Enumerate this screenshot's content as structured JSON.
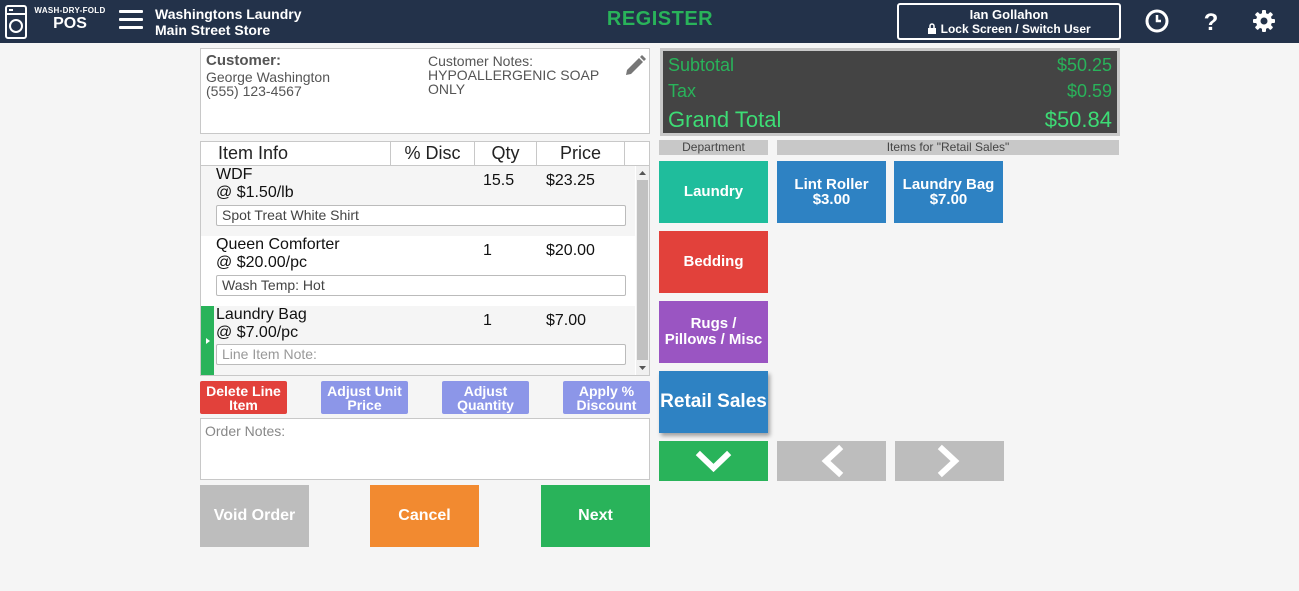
{
  "header": {
    "brand_small": "WASH-DRY-FOLD",
    "brand_big": "POS",
    "store_name": "Washingtons Laundry",
    "store_location": "Main Street Store",
    "title": "REGISTER",
    "user_name": "Ian Gollahon",
    "lock_label": "Lock Screen / Switch User"
  },
  "customer": {
    "label": "Customer:",
    "name": "George Washington",
    "phone": "(555) 123-4567",
    "notes_label": "Customer Notes:",
    "notes_line1": "HYPOALLERGENIC SOAP",
    "notes_line2": "ONLY"
  },
  "table": {
    "headers": [
      "Item Info",
      "% Disc",
      "Qty",
      "Price"
    ],
    "rows": [
      {
        "name": "WDF",
        "rate": "@ $1.50/lb",
        "qty": "15.5",
        "price": "$23.25",
        "note": "Spot Treat White Shirt"
      },
      {
        "name": "Queen Comforter",
        "rate": "@ $20.00/pc",
        "qty": "1",
        "price": "$20.00",
        "note": "Wash Temp: Hot"
      },
      {
        "name": "Laundry Bag",
        "rate": "@ $7.00/pc",
        "qty": "1",
        "price": "$7.00",
        "note_placeholder": "Line Item Note:"
      }
    ]
  },
  "actions": {
    "delete": "Delete Line Item",
    "adjust_price": "Adjust Unit Price",
    "adjust_qty": "Adjust Quantity",
    "apply_discount": "Apply % Discount"
  },
  "order_notes_placeholder": "Order Notes:",
  "buttons": {
    "void": "Void Order",
    "cancel": "Cancel",
    "next": "Next"
  },
  "totals": {
    "subtotal_label": "Subtotal",
    "subtotal": "$50.25",
    "tax_label": "Tax",
    "tax": "$0.59",
    "grand_label": "Grand Total",
    "grand": "$50.84"
  },
  "department_header": "Department",
  "items_header": "Items for \"Retail Sales\"",
  "departments": [
    {
      "label": "Laundry",
      "color": "#1fbd9c"
    },
    {
      "label": "Bedding",
      "color": "#e2413b"
    },
    {
      "label": "Rugs / Pillows / Misc",
      "color": "#9a55c2"
    },
    {
      "label": "Retail Sales",
      "color": "#2e82c3"
    }
  ],
  "retail_items": [
    {
      "name": "Lint Roller",
      "price": "$3.00"
    },
    {
      "name": "Laundry Bag",
      "price": "$7.00"
    }
  ],
  "colors": {
    "topbar": "#23324a",
    "green": "#29b35a",
    "red": "#e2413b",
    "lavender": "#8c96e8",
    "orange": "#f28a30",
    "gray": "#bdbdbd"
  }
}
